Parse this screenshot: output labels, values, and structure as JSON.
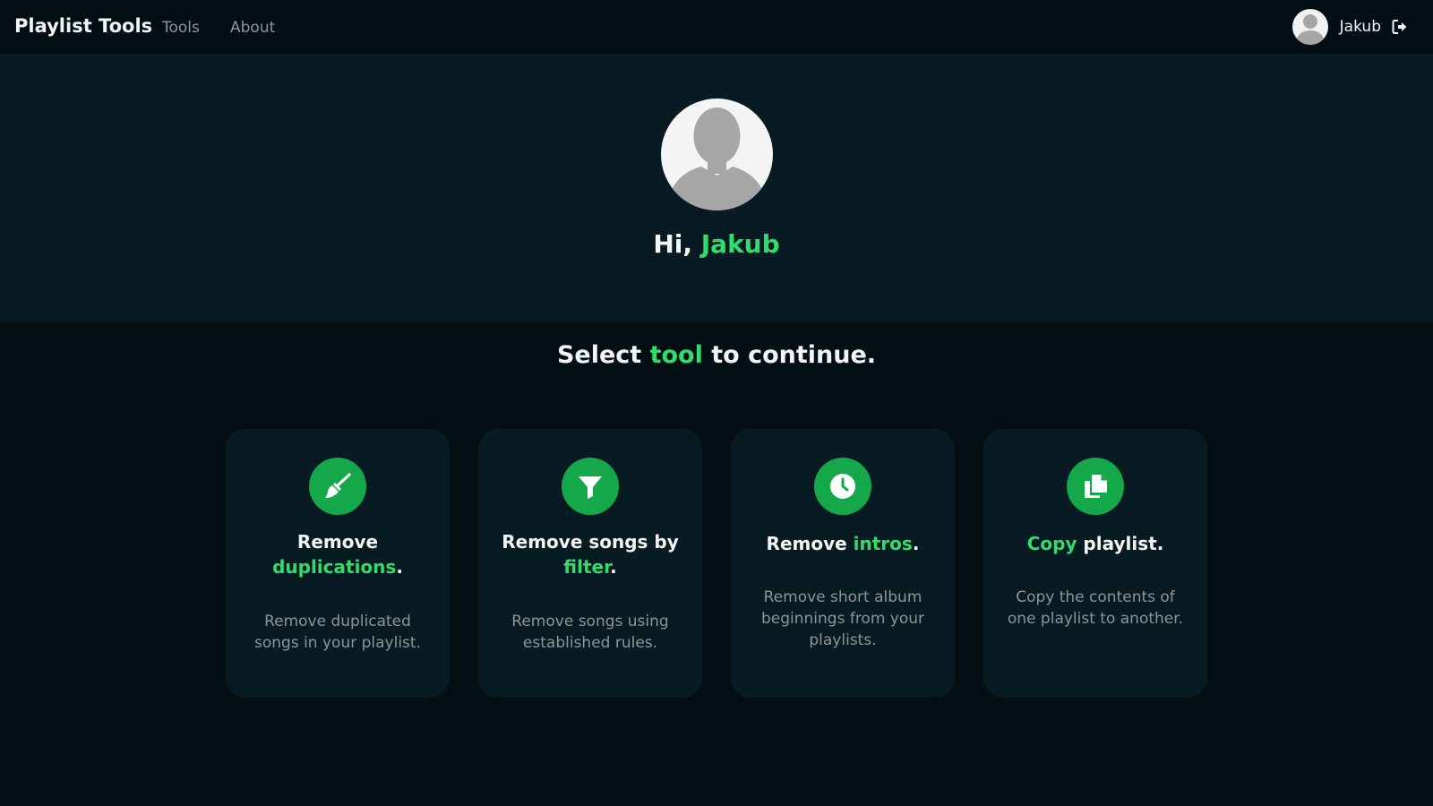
{
  "navbar": {
    "brand": "Playlist Tools",
    "links": [
      "Tools",
      "About"
    ],
    "user_name": "Jakub"
  },
  "hero": {
    "greeting_prefix": "Hi, ",
    "greeting_name": "Jakub"
  },
  "select": {
    "prefix": "Select ",
    "highlight": "tool",
    "suffix": " to continue."
  },
  "cards": [
    {
      "icon": "broom-icon",
      "title_before": "Remove ",
      "title_highlight": "duplications",
      "title_after": ".",
      "description": "Remove duplicated songs in your playlist."
    },
    {
      "icon": "filter-icon",
      "title_before": "Remove songs by ",
      "title_highlight": "filter",
      "title_after": ".",
      "description": "Remove songs using established rules."
    },
    {
      "icon": "clock-icon",
      "title_before": "Remove ",
      "title_highlight": "intros",
      "title_after": ".",
      "description": "Remove short album beginnings from your playlists."
    },
    {
      "icon": "copy-icon",
      "title_before": "",
      "title_highlight": "Copy",
      "title_after": " playlist.",
      "description": "Copy the contents of one playlist to another."
    }
  ],
  "colors": {
    "accent": "#2fdc6c",
    "icon_bg": "#14a84a",
    "card_bg": "#081b22",
    "page_bg": "#040f14",
    "muted_text": "#8d9599"
  }
}
